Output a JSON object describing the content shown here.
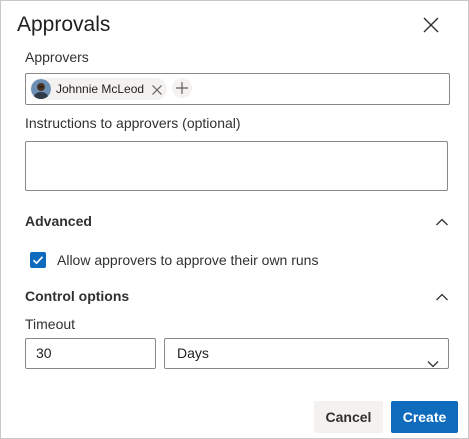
{
  "dialog": {
    "title": "Approvals"
  },
  "approvers": {
    "label": "Approvers",
    "selected": [
      {
        "name": "Johnnie McLeod"
      }
    ]
  },
  "instructions": {
    "label": "Instructions to approvers (optional)",
    "value": ""
  },
  "advanced": {
    "header": "Advanced",
    "expanded": true,
    "allow_self_approve": {
      "label": "Allow approvers to approve their own runs",
      "checked": true
    }
  },
  "control_options": {
    "header": "Control options",
    "expanded": true,
    "timeout": {
      "label": "Timeout",
      "value": "30",
      "unit": "Days"
    }
  },
  "footer": {
    "cancel_label": "Cancel",
    "create_label": "Create"
  },
  "colors": {
    "primary": "#0f6cbd",
    "secondary_button": "#f3f2f1",
    "border": "#8a8886"
  }
}
